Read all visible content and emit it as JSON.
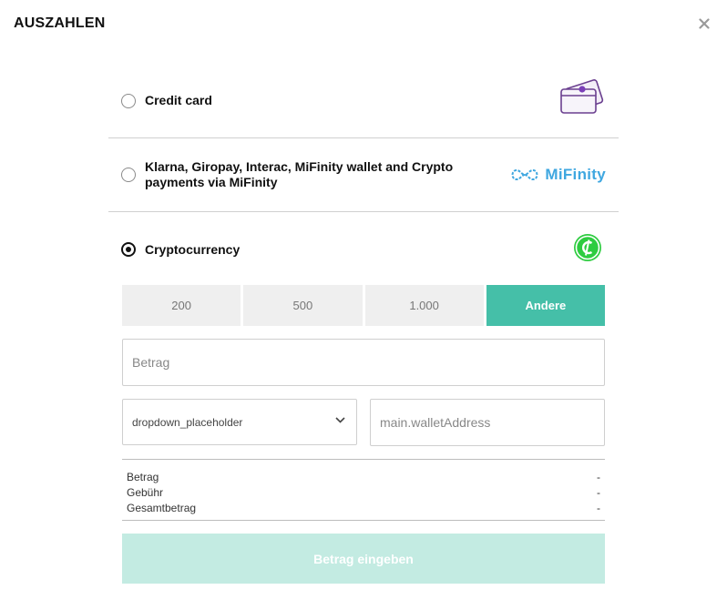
{
  "header": {
    "title": "AUSZAHLEN",
    "close_icon": "close-icon"
  },
  "methods": [
    {
      "label": "Credit card",
      "selected": false,
      "logo": "credit-card-icon"
    },
    {
      "label": "Klarna, Giropay, Interac, MiFinity wallet and Crypto payments via MiFinity",
      "selected": false,
      "logo": "mifinity-logo",
      "logo_text": "MiFinity"
    },
    {
      "label": "Cryptocurrency",
      "selected": true,
      "logo": "cryptocurrency-icon"
    }
  ],
  "amounts": [
    "200",
    "500",
    "1.000",
    "Andere"
  ],
  "amounts_active": "Andere",
  "form": {
    "amount_placeholder": "Betrag",
    "currency_placeholder": "dropdown_placeholder",
    "wallet_placeholder": "main.walletAddress"
  },
  "summary": [
    {
      "label": "Betrag",
      "value": "-"
    },
    {
      "label": "Gebühr",
      "value": "-"
    },
    {
      "label": "Gesamtbetrag",
      "value": "-"
    }
  ],
  "submit_label": "Betrag eingeben",
  "colors": {
    "accent": "#45bfa8",
    "accent_disabled": "#c3ebe2",
    "mifinity_blue": "#3fa7e0",
    "card_purple": "#6a3f8f",
    "crypto_green": "#2ecc40"
  }
}
